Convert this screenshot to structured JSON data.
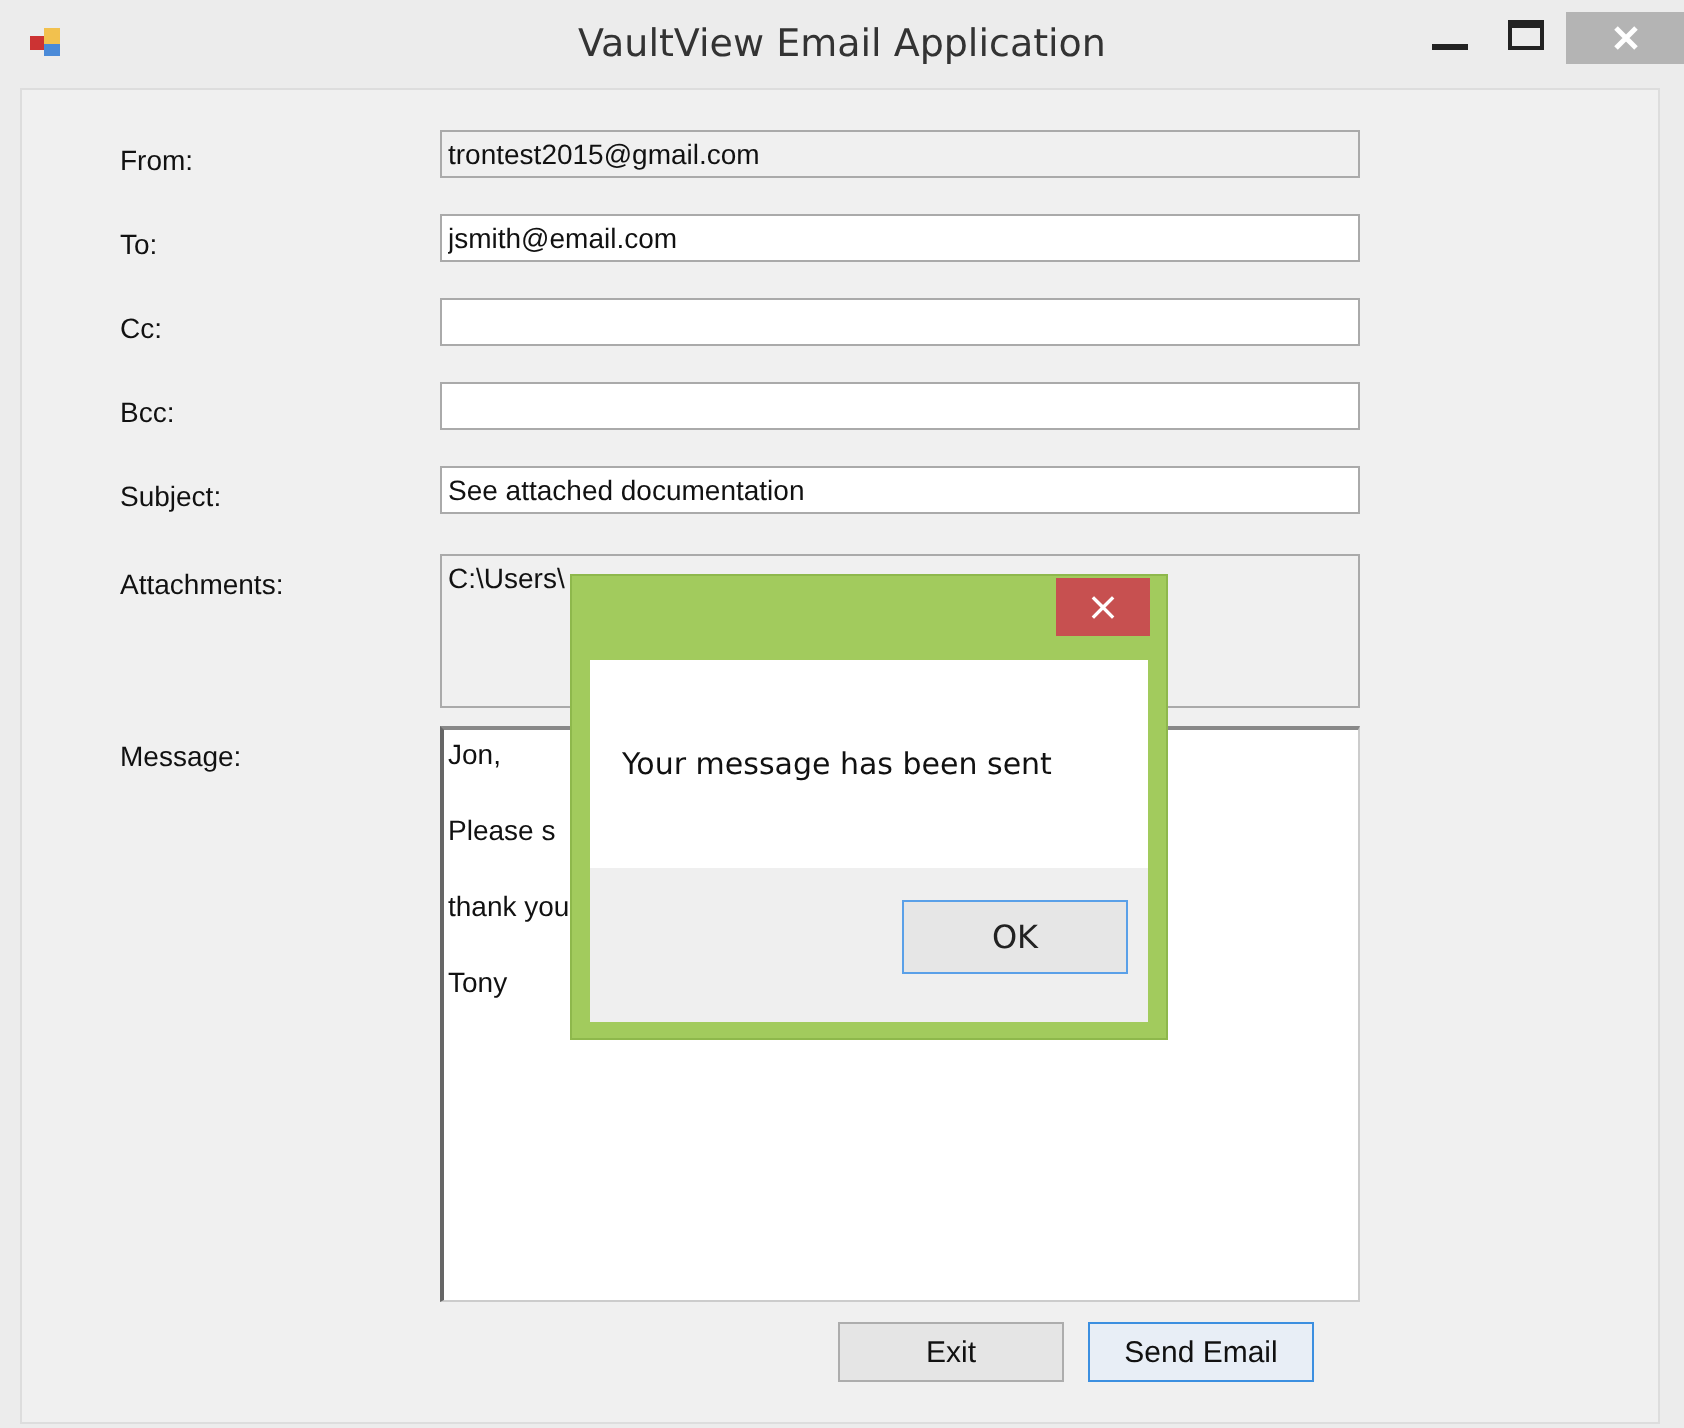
{
  "window": {
    "title": "VaultView Email Application"
  },
  "fields": [
    {
      "label": "From:",
      "value": "trontest2015@gmail.com",
      "kind": "readonly"
    },
    {
      "label": "To:",
      "value": "jsmith@email.com",
      "kind": "text"
    },
    {
      "label": "Cc:",
      "kind": "text"
    },
    {
      "label": "Bcc:",
      "kind": "text"
    },
    {
      "label": "Subject:",
      "value": "See attached documentation",
      "kind": "text"
    },
    {
      "label": "Attachments:",
      "value": "C:\\Users\\",
      "kind": "area"
    }
  ],
  "message": {
    "label": "Message:",
    "lines": [
      "Jon,",
      "Please s",
      "thank you",
      "Tony"
    ]
  },
  "buttons": [
    {
      "label": "Exit",
      "focused": false
    },
    {
      "label": "Send Email",
      "focused": true
    }
  ],
  "dialog": {
    "close": "×",
    "text": "Your message has been sent",
    "button": "OK"
  }
}
